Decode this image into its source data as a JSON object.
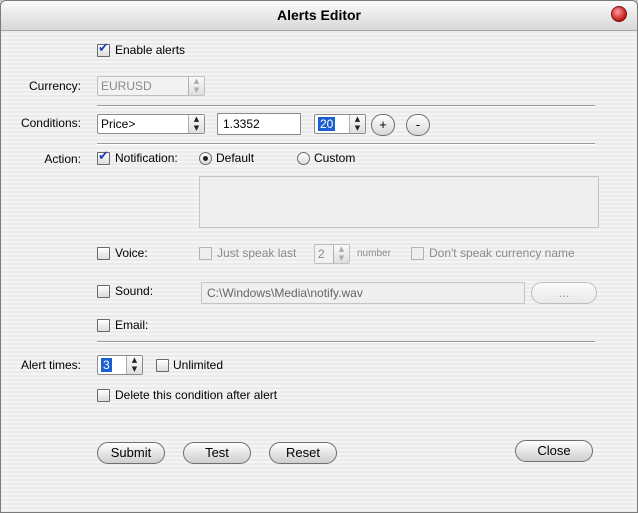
{
  "window": {
    "title": "Alerts Editor"
  },
  "enable_alerts": {
    "label": "Enable alerts",
    "checked": true
  },
  "currency": {
    "label": "Currency:",
    "value": "EURUSD"
  },
  "conditions": {
    "label": "Conditions:",
    "field": "Price>",
    "value": "1.3352",
    "count": "20",
    "add_label": "+",
    "remove_label": "-"
  },
  "action": {
    "label": "Action:",
    "notification_label": "Notification:",
    "default_label": "Default",
    "custom_label": "Custom",
    "voice_label": "Voice:",
    "just_speak_last_label": "Just speak last",
    "speak_count": "2",
    "number_label": "number",
    "dont_speak_label": "Don't speak currency name",
    "sound_label": "Sound:",
    "sound_path": "C:\\Windows\\Media\\notify.wav",
    "browse_label": "...",
    "email_label": "Email:"
  },
  "alert_times": {
    "label": "Alert times:",
    "value": "3",
    "unlimited_label": "Unlimited",
    "delete_label": "Delete this condition after alert"
  },
  "buttons": {
    "submit": "Submit",
    "test": "Test",
    "reset": "Reset",
    "close": "Close"
  }
}
